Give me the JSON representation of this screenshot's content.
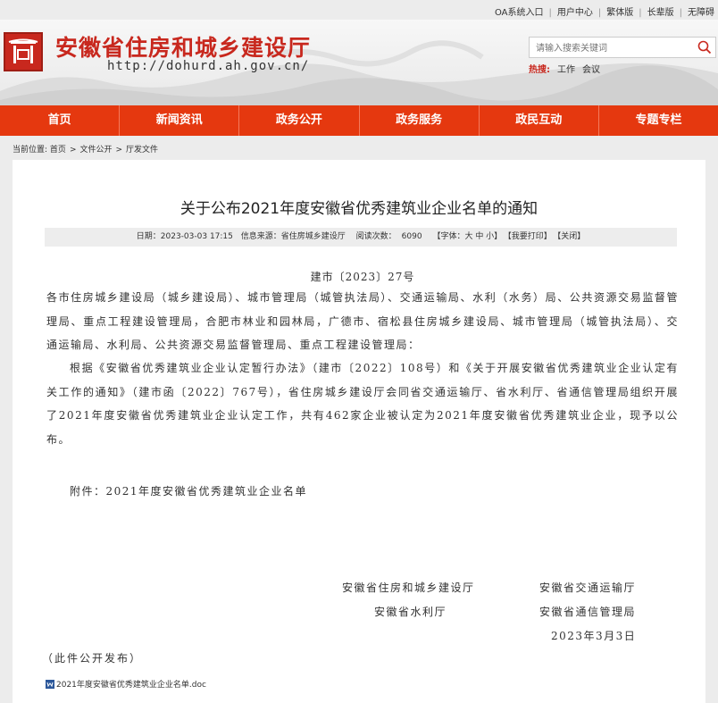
{
  "toplinks": [
    "OA系统入口",
    "用户中心",
    "繁体版",
    "长辈版",
    "无障碍"
  ],
  "header": {
    "title": "安徽省住房和城乡建设厅",
    "url": "http://dohurd.ah.gov.cn/"
  },
  "search": {
    "placeholder": "请输入搜索关键词",
    "hot_label": "热搜:",
    "hot_terms": [
      "工作",
      "会议"
    ]
  },
  "nav": [
    "首页",
    "新闻资讯",
    "政务公开",
    "政务服务",
    "政民互动",
    "专题专栏"
  ],
  "breadcrumb": {
    "label": "当前位置:",
    "items": [
      "首页",
      "文件公开",
      "厅发文件"
    ],
    "sep": ">"
  },
  "article": {
    "title": "关于公布2021年度安徽省优秀建筑业企业名单的通知",
    "meta": {
      "date": "日期：2023-03-03 17:15",
      "source": "信息来源：省住房城乡建设厅",
      "reads": "阅读次数：",
      "read_count": "6090",
      "font": "【字体：大 中 小】",
      "print": "【我要打印】",
      "close": "【关闭】"
    },
    "doc_number": "建市〔2023〕27号",
    "para1": "各市住房城乡建设局（城乡建设局）、城市管理局（城管执法局）、交通运输局、水利（水务）局、公共资源交易监督管理局、重点工程建设管理局，合肥市林业和园林局，广德市、宿松县住房城乡建设局、城市管理局（城管执法局）、交通运输局、水利局、公共资源交易监督管理局、重点工程建设管理局：",
    "para2": "根据《安徽省优秀建筑业企业认定暂行办法》（建市〔2022〕108号）和《关于开展安徽省优秀建筑业企业认定有关工作的通知》（建市函〔2022〕767号），省住房城乡建设厅会同省交通运输厅、省水利厅、省通信管理局组织开展了2021年度安徽省优秀建筑业企业认定工作，共有462家企业被认定为2021年度安徽省优秀建筑业企业，现予以公布。",
    "attachment": "附件：2021年度安徽省优秀建筑业企业名单",
    "signers": [
      "安徽省住房和城乡建设厅",
      "安徽省交通运输厅",
      "安徽省水利厅",
      "安徽省通信管理局"
    ],
    "sign_date": "2023年3月3日",
    "public_note": "（此件公开发布）",
    "file_link": "2021年度安徽省优秀建筑业企业名单.doc"
  },
  "colors": {
    "brand_red": "#c8281e",
    "nav_orange": "#e5380f"
  },
  "icons": [
    "emblem-logo",
    "search-icon",
    "word-doc-icon"
  ]
}
